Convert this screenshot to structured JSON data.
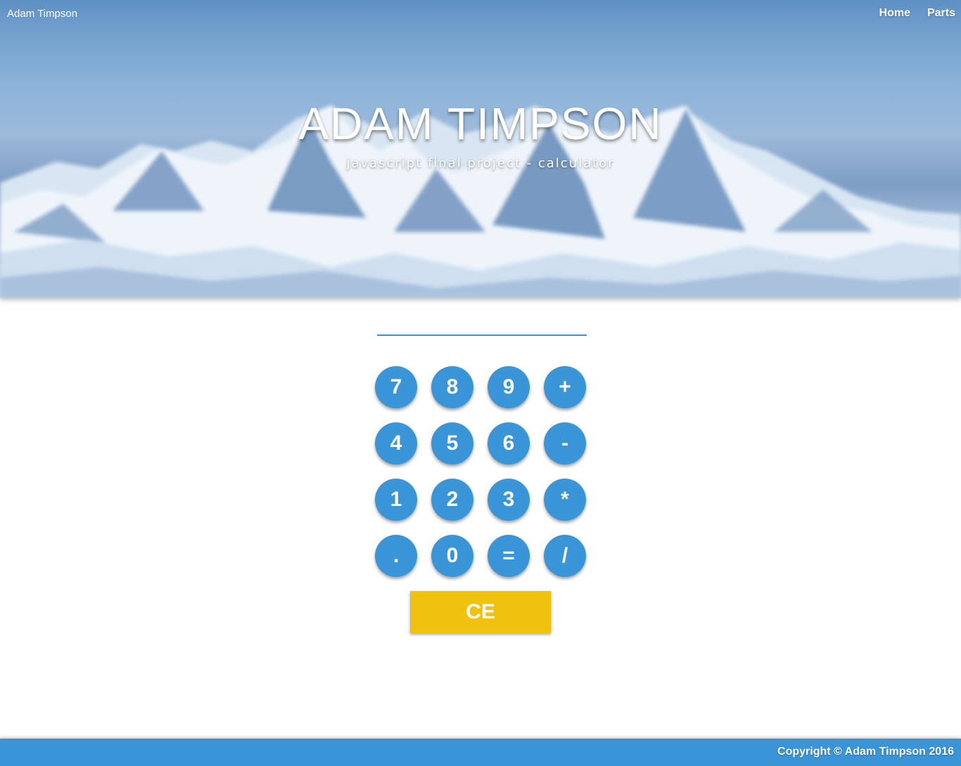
{
  "nav": {
    "brand": "Adam Timpson",
    "links": [
      "Home",
      "Parts"
    ]
  },
  "hero": {
    "title": "ADAM TIMPSON",
    "subtitle": "javascript final project - calculator"
  },
  "calculator": {
    "display_value": "",
    "keys": [
      "7",
      "8",
      "9",
      "+",
      "4",
      "5",
      "6",
      "-",
      "1",
      "2",
      "3",
      "*",
      ".",
      "0",
      "=",
      "/"
    ],
    "clear_label": "CE"
  },
  "footer": {
    "copyright": "Copyright © Adam Timpson 2016"
  },
  "colors": {
    "accent_blue": "#3a94d8",
    "clear_yellow": "#f0c20f",
    "text_white": "#ffffff"
  }
}
